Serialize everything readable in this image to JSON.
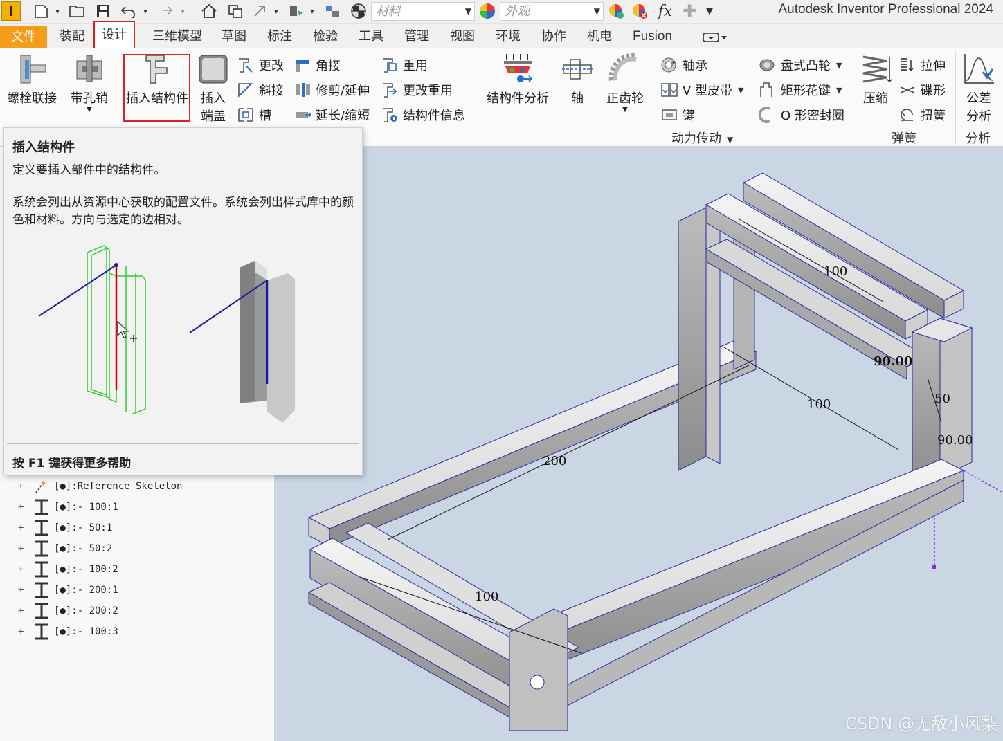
{
  "app": {
    "title": "Autodesk Inventor Professional 2024",
    "logo_letter": "I"
  },
  "quick_access": {
    "material_placeholder": "材料",
    "appearance_placeholder": "外观",
    "formula_label": "fx"
  },
  "tabs": [
    {
      "label": "文件"
    },
    {
      "label": "装配"
    },
    {
      "label": "设计"
    },
    {
      "label": "三维模型"
    },
    {
      "label": "草图"
    },
    {
      "label": "标注"
    },
    {
      "label": "检验"
    },
    {
      "label": "工具"
    },
    {
      "label": "管理"
    },
    {
      "label": "视图"
    },
    {
      "label": "环境"
    },
    {
      "label": "协作"
    },
    {
      "label": "机电"
    },
    {
      "label": "Fusion"
    }
  ],
  "ribbon": {
    "bolt": "螺栓联接",
    "clevis": "带孔销",
    "insert_frame": "插入结构件",
    "insert_endcap_1": "插入",
    "insert_endcap_2": "端盖",
    "change": "更改",
    "miter": "斜接",
    "notch": "槽",
    "corner": "角接",
    "trim_extend": "修剪/延伸",
    "lengthen_shorten": "延长/缩短",
    "reuse": "重用",
    "change_reuse": "更改重用",
    "frame_info": "结构件信息",
    "frame_analysis": "结构件分析",
    "shaft": "轴",
    "spur_gear": "正齿轮",
    "bearing": "轴承",
    "vbelt": "V 型皮带",
    "key": "键",
    "disc_cam": "盘式凸轮",
    "spline": "矩形花键",
    "oring": "O 形密封圈",
    "power_transmission": "动力传动",
    "compression": "压缩",
    "extension": "拉伸",
    "belleville": "碟形",
    "torsion": "扭簧",
    "spring_panel": "弹簧",
    "tolerance_analysis_1": "公差",
    "tolerance_analysis_2": "分析",
    "analysis_panel": "分析"
  },
  "tooltip": {
    "title": "插入结构件",
    "description": "定义要插入部件中的结构件。",
    "detail": "系统会列出从资源中心获取的配置文件。系统会列出样式库中的颜色和材料。方向与选定的边相对。",
    "help": "按 F1 键获得更多帮助"
  },
  "browser_tree": [
    {
      "label": "[●]:Reference Skeleton",
      "icon": "skeleton-icon"
    },
    {
      "label": "[●]:- 100:1",
      "icon": "ibeam-icon"
    },
    {
      "label": "[●]:- 50:1",
      "icon": "ibeam-icon"
    },
    {
      "label": "[●]:- 50:2",
      "icon": "ibeam-icon"
    },
    {
      "label": "[●]:- 100:2",
      "icon": "ibeam-icon"
    },
    {
      "label": "[●]:- 200:1",
      "icon": "ibeam-icon"
    },
    {
      "label": "[●]:- 200:2",
      "icon": "ibeam-icon"
    },
    {
      "label": "[●]:- 100:3",
      "icon": "ibeam-icon"
    }
  ],
  "viewport": {
    "dimensions": [
      "100",
      "100",
      "100",
      "200",
      "50",
      "90.00",
      "90.00"
    ]
  },
  "watermark": "CSDN @无敌小风梨",
  "colors": {
    "file_tab": "#f39d1a",
    "highlight": "#e02020",
    "viewport_bg": "#cbd6e4",
    "sketch_blue": "#1a1aa0"
  }
}
